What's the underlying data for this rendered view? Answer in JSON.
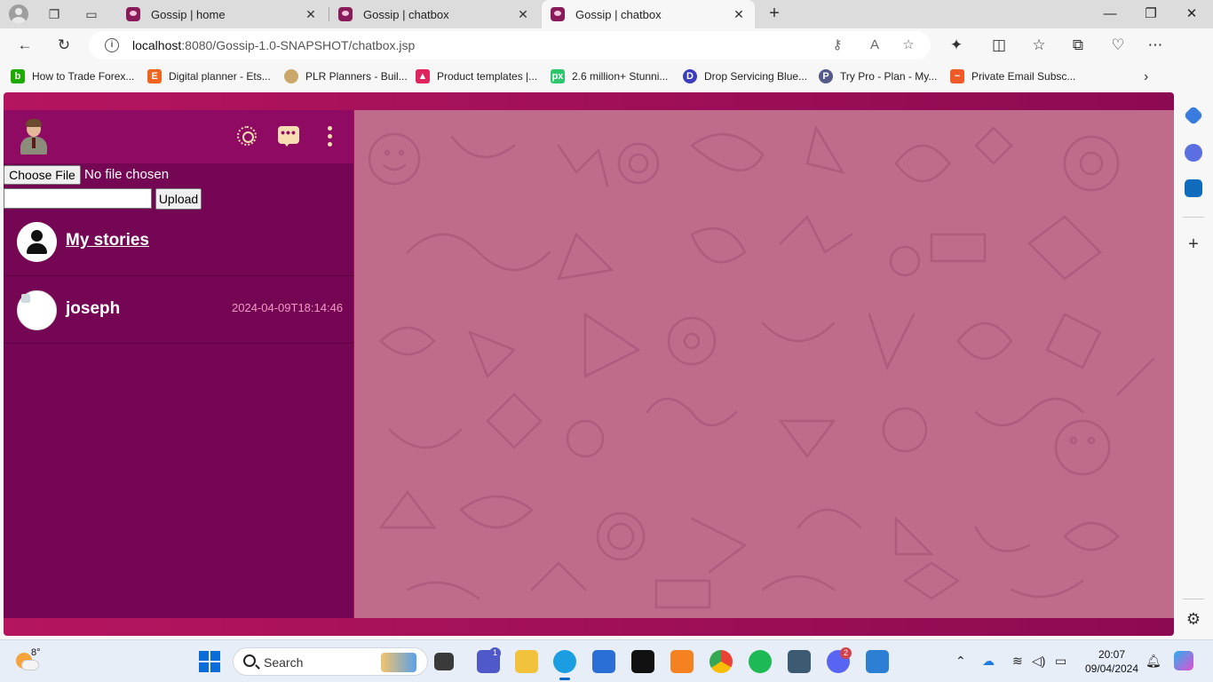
{
  "browser": {
    "tabs": [
      {
        "title": "Gossip | home",
        "active": false
      },
      {
        "title": "Gossip | chatbox",
        "active": false
      },
      {
        "title": "Gossip | chatbox",
        "active": true
      }
    ],
    "url_host": "localhost",
    "url_path": ":8080/Gossip-1.0-SNAPSHOT/chatbox.jsp",
    "bookmarks": [
      {
        "label": "How to Trade Forex...",
        "icon": "b-icon",
        "color": "#1faa00"
      },
      {
        "label": "Digital planner - Ets...",
        "icon": "etsy-icon",
        "color": "#f1641e"
      },
      {
        "label": "PLR Planners - Buil...",
        "icon": "plr-icon",
        "color": "#c9a86a"
      },
      {
        "label": "Product templates |...",
        "icon": "templates-icon",
        "color": "#e0245e"
      },
      {
        "label": "2.6 million+ Stunni...",
        "icon": "pixabay-icon",
        "color": "#2ec66d"
      },
      {
        "label": "Drop Servicing Blue...",
        "icon": "drop-icon",
        "color": "#3c3cbf"
      },
      {
        "label": "Try Pro - Plan - My...",
        "icon": "pro-icon",
        "color": "#555a88"
      },
      {
        "label": "Private Email Subsc...",
        "icon": "email-icon",
        "color": "#f05a28"
      }
    ]
  },
  "app": {
    "file_button": "Choose File",
    "file_status": "No file chosen",
    "upload_button": "Upload",
    "upload_text_value": "",
    "stories_label": "My stories",
    "contacts": [
      {
        "name": "joseph",
        "time": "2024-04-09T18:14:46"
      }
    ],
    "colors": {
      "header": "#8f0b63",
      "panel": "#750654",
      "chat_background": "#bf6b8c",
      "accent_icons": "#f9ddb2",
      "timestamp": "#f19ac2"
    }
  },
  "taskbar": {
    "weather_temp": "8°",
    "search_placeholder": "Search",
    "teams_badge": "1",
    "discord_badge": "2",
    "time": "20:07",
    "date": "09/04/2024"
  }
}
